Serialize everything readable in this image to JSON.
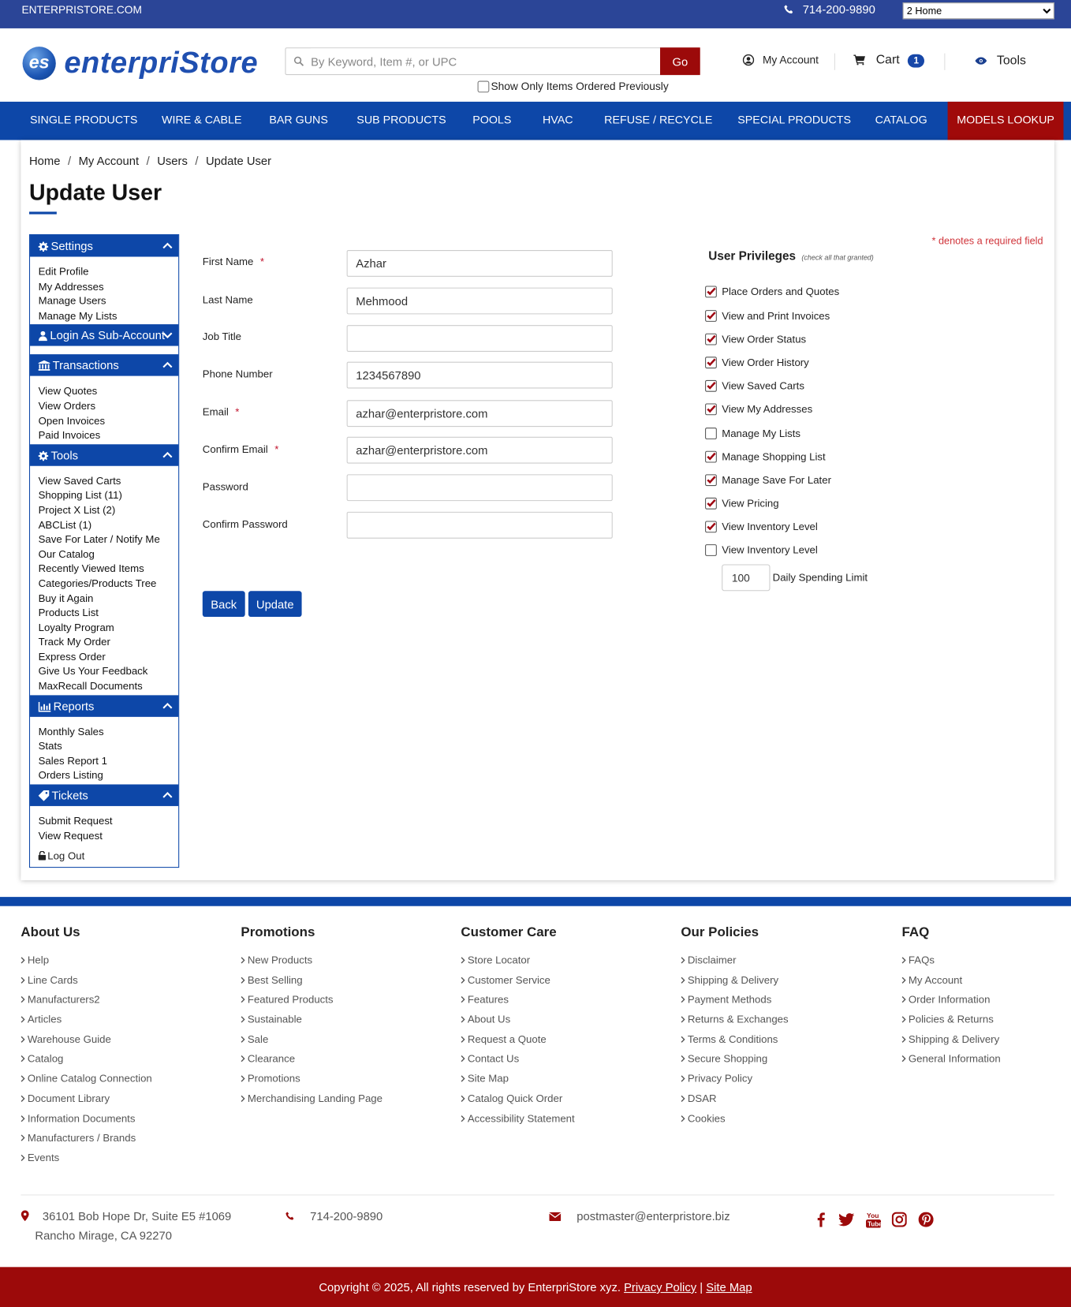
{
  "topbar": {
    "site": "ENTERPRISTORE.COM",
    "phone": "714-200-9890",
    "store_select": "2 Home"
  },
  "header": {
    "logo_badge": "es",
    "logo_text": "enterpriStore",
    "search_placeholder": "By Keyword, Item #, or UPC",
    "go": "Go",
    "only_ordered": "Show Only Items Ordered Previously",
    "my_account": "My Account",
    "cart": "Cart",
    "cart_count": "1",
    "tools": "Tools"
  },
  "nav": [
    "SINGLE PRODUCTS",
    "WIRE & CABLE",
    "BAR GUNS",
    "SUB PRODUCTS",
    "POOLS",
    "HVAC",
    "REFUSE / RECYCLE",
    "SPECIAL PRODUCTS",
    "CATALOG",
    "MODELS LOOKUP"
  ],
  "breadcrumb": [
    "Home",
    "My Account",
    "Users",
    "Update User"
  ],
  "page_title": "Update User",
  "sidebar": {
    "settings": {
      "title": "Settings",
      "items": [
        "Edit Profile",
        "My Addresses",
        "Manage Users",
        "Manage My Lists"
      ]
    },
    "login_sub": {
      "title": "Login As Sub-Account"
    },
    "transactions": {
      "title": "Transactions",
      "items": [
        "View Quotes",
        "View Orders",
        "Open Invoices",
        "Paid Invoices"
      ]
    },
    "tools": {
      "title": "Tools",
      "items": [
        "View Saved Carts",
        "Shopping List (11)",
        "Project X List (2)",
        "ABCList (1)",
        "Save For Later / Notify Me",
        "Our Catalog",
        "Recently Viewed Items",
        "Categories/Products Tree",
        "Buy it Again",
        "Products List",
        "Loyalty Program",
        "Track My Order",
        "Express Order",
        "Give Us Your Feedback",
        "MaxRecall Documents"
      ]
    },
    "reports": {
      "title": "Reports",
      "items": [
        "Monthly Sales",
        "Stats",
        "Sales Report 1",
        "Orders Listing"
      ]
    },
    "tickets": {
      "title": "Tickets",
      "items": [
        "Submit Request",
        "View Request"
      ]
    },
    "logout": "Log Out"
  },
  "form": {
    "fields": [
      {
        "label": "First Name",
        "required": true,
        "value": "Azhar"
      },
      {
        "label": "Last Name",
        "required": false,
        "value": "Mehmood"
      },
      {
        "label": "Job Title",
        "required": false,
        "value": ""
      },
      {
        "label": "Phone Number",
        "required": false,
        "value": "1234567890"
      },
      {
        "label": "Email",
        "required": true,
        "value": "azhar@enterpristore.com"
      },
      {
        "label": "Confirm Email",
        "required": true,
        "value": "azhar@enterpristore.com"
      },
      {
        "label": "Password",
        "required": false,
        "value": ""
      },
      {
        "label": "Confirm Password",
        "required": false,
        "value": ""
      }
    ],
    "required_mark": "*",
    "back": "Back",
    "update": "Update"
  },
  "privileges": {
    "required_note": "* denotes a required field",
    "title": "User Privileges",
    "hint": "(check all that granted)",
    "items": [
      {
        "label": "Place Orders and Quotes",
        "checked": true
      },
      {
        "label": "View and Print Invoices",
        "checked": true
      },
      {
        "label": "View Order Status",
        "checked": true
      },
      {
        "label": "View Order History",
        "checked": true
      },
      {
        "label": "View Saved Carts",
        "checked": true
      },
      {
        "label": "View My Addresses",
        "checked": true
      },
      {
        "label": "Manage My Lists",
        "checked": false
      },
      {
        "label": "Manage Shopping List",
        "checked": true
      },
      {
        "label": "Manage Save For Later",
        "checked": true
      },
      {
        "label": "View Pricing",
        "checked": true
      },
      {
        "label": "View Inventory Level",
        "checked": true
      },
      {
        "label": "View Inventory Level",
        "checked": false
      }
    ],
    "spending_limit": "100",
    "spending_label": "Daily Spending Limit"
  },
  "footer": {
    "columns": [
      {
        "title": "About Us",
        "links": [
          "Help",
          "Line Cards",
          "Manufacturers2",
          "Articles",
          "Warehouse Guide",
          "Catalog",
          "Online Catalog Connection",
          "Document Library",
          "Information Documents",
          "Manufacturers / Brands",
          "Events"
        ]
      },
      {
        "title": "Promotions",
        "links": [
          "New Products",
          "Best Selling",
          "Featured Products",
          "Sustainable",
          "Sale",
          "Clearance",
          "Promotions",
          "Merchandising Landing Page"
        ]
      },
      {
        "title": "Customer Care",
        "links": [
          "Store Locator",
          "Customer Service",
          "Features",
          "About Us",
          "Request a Quote",
          "Contact Us",
          "Site Map",
          "Catalog Quick Order",
          "Accessibility Statement"
        ]
      },
      {
        "title": "Our Policies",
        "links": [
          "Disclaimer",
          "Shipping & Delivery",
          "Payment Methods",
          "Returns & Exchanges",
          "Terms & Conditions",
          "Secure Shopping",
          "Privacy Policy",
          "DSAR",
          "Cookies"
        ]
      },
      {
        "title": "FAQ",
        "links": [
          "FAQs",
          "My Account",
          "Order Information",
          "Policies & Returns",
          "Shipping & Delivery",
          "General Information"
        ]
      }
    ],
    "address1": "36101 Bob Hope Dr, Suite E5 #1069",
    "address2": "Rancho Mirage, CA 92270",
    "phone": "714-200-9890",
    "email": "postmaster@enterpristore.biz",
    "copyright": "Copyright © 2025, All rights reserved by EnterpriStore xyz.",
    "privacy": "Privacy Policy",
    "sep": "|",
    "sitemap": "Site Map"
  },
  "colors": {
    "brand_blue": "#0d47a8",
    "topbar": "#2b4597",
    "accent_red": "#9c0a0a",
    "required": "#c0102a"
  }
}
